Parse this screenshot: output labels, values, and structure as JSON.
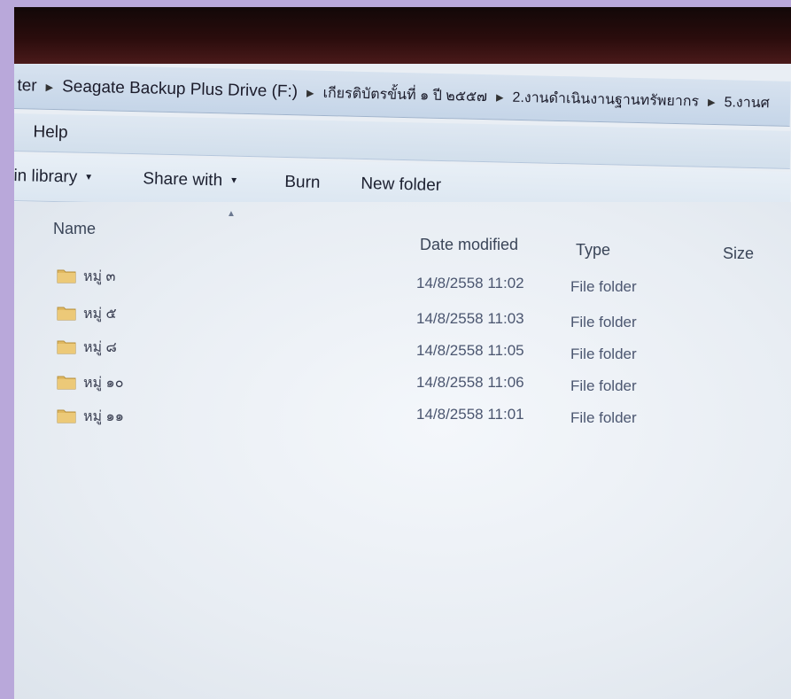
{
  "breadcrumb": {
    "items": [
      "ter",
      "Seagate Backup Plus Drive (F:)",
      "เกียรติบัตรขั้นที่ ๑ ปี ๒๕๕๗",
      "2.งานดำเนินงานฐานทรัพยากร",
      "5.งานศ"
    ]
  },
  "menu": {
    "help": "Help"
  },
  "toolbar": {
    "include_in_library": "in library",
    "share_with": "Share with",
    "burn": "Burn",
    "new_folder": "New folder"
  },
  "columns": {
    "name": "Name",
    "date_modified": "Date modified",
    "type": "Type",
    "size": "Size"
  },
  "files": [
    {
      "name": "หมู่ ๓",
      "date": "14/8/2558 11:02",
      "type": "File folder",
      "icon": "folder-icon"
    },
    {
      "name": "หมู่ ๕",
      "date": "14/8/2558 11:03",
      "type": "File folder",
      "icon": "folder-icon"
    },
    {
      "name": "หมู่ ๘",
      "date": "14/8/2558 11:05",
      "type": "File folder",
      "icon": "folder-icon"
    },
    {
      "name": "หมู่ ๑๐",
      "date": "14/8/2558 11:06",
      "type": "File folder",
      "icon": "folder-icon"
    },
    {
      "name": "หมู่ ๑๑",
      "date": "14/8/2558 11:01",
      "type": "File folder",
      "icon": "folder-icon"
    }
  ],
  "colors": {
    "frame": "#b9a8da",
    "folder": "#e0b860",
    "text": "#3a3f52"
  }
}
